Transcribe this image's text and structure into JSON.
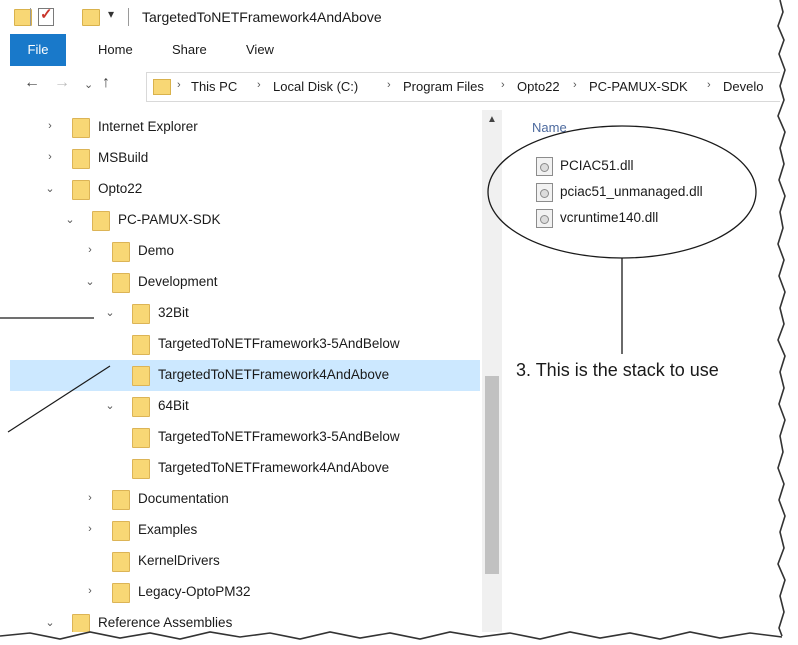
{
  "window": {
    "title": "TargetedToNETFramework4AndAbove",
    "quick_access_dropdown": "▾"
  },
  "ribbon": {
    "tabs": [
      "File",
      "Home",
      "Share",
      "View"
    ],
    "active_tab": "File",
    "accent_color": "#1979ca"
  },
  "navigation": {
    "back_icon": "←",
    "forward_icon": "→",
    "recent_icon": "⌄",
    "up_icon": "↑"
  },
  "address": {
    "separator": "›",
    "breadcrumbs": [
      "This PC",
      "Local Disk (C:)",
      "Program Files",
      "Opto22",
      "PC-PAMUX-SDK",
      "Develo"
    ]
  },
  "tree": {
    "items": [
      {
        "label": "Internet Explorer",
        "chevron": "›"
      },
      {
        "label": "MSBuild",
        "chevron": "›"
      },
      {
        "label": "Opto22",
        "chevron": "⌄"
      },
      {
        "label": "PC-PAMUX-SDK",
        "chevron": "⌄"
      },
      {
        "label": "Demo",
        "chevron": "›"
      },
      {
        "label": "Development",
        "chevron": "⌄"
      },
      {
        "label": "32Bit",
        "chevron": "⌄"
      },
      {
        "label": "TargetedToNETFramework3-5AndBelow",
        "chevron": ""
      },
      {
        "label": "TargetedToNETFramework4AndAbove",
        "chevron": ""
      },
      {
        "label": "64Bit",
        "chevron": "⌄"
      },
      {
        "label": "TargetedToNETFramework3-5AndBelow",
        "chevron": ""
      },
      {
        "label": "TargetedToNETFramework4AndAbove",
        "chevron": ""
      },
      {
        "label": "Documentation",
        "chevron": "›"
      },
      {
        "label": "Examples",
        "chevron": "›"
      },
      {
        "label": "KernelDrivers",
        "chevron": ""
      },
      {
        "label": "Legacy-OptoPM32",
        "chevron": "›"
      },
      {
        "label": "Reference Assemblies",
        "chevron": "⌄"
      }
    ],
    "selected_label": "TargetedToNETFramework4AndAbove",
    "selection_color": "#cce8ff",
    "folder_color": "#f8d775"
  },
  "scrollbar": {
    "up_arrow": "▲"
  },
  "content": {
    "column_header": "Name",
    "files": [
      "PCIAC51.dll",
      "pciac51_unmanaged.dll",
      "vcruntime140.dll"
    ]
  },
  "annotation": {
    "callout": "3. This is the stack to use"
  }
}
